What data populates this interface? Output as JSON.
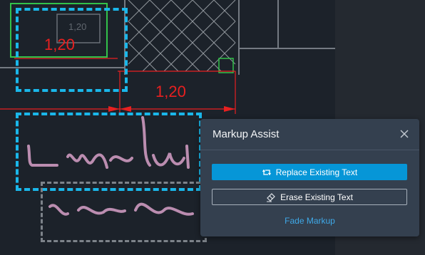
{
  "drawing": {
    "dimension_label_1": "1,20",
    "dimension_label_2": "1,20",
    "faint_label": "1,20"
  },
  "panel": {
    "title": "Markup Assist",
    "replace_button_label": "Replace Existing Text",
    "erase_button_label": "Erase Existing Text",
    "fade_link_label": "Fade Markup",
    "icons": {
      "close": "close-icon",
      "replace": "replace-text-icon",
      "erase": "eraser-icon"
    }
  },
  "colors": {
    "canvas_bg": "#1c222a",
    "dimension_red": "#e82020",
    "selection_blue": "#1ab7ea",
    "panel_bg": "#34404f",
    "primary_button": "#0696d7",
    "link": "#3fa9e8",
    "markup_pink": "#d7a0c8"
  }
}
